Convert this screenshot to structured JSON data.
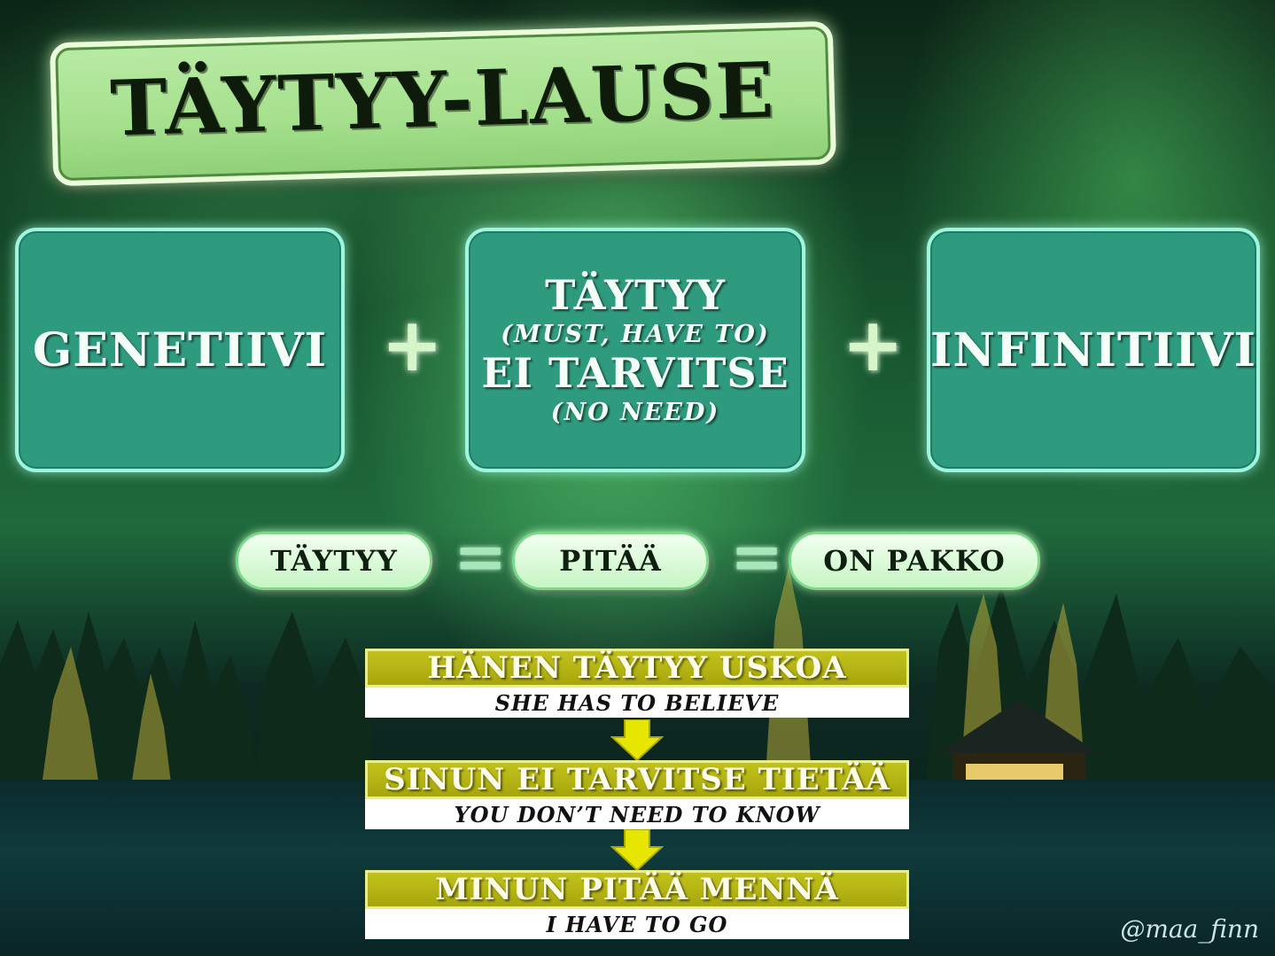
{
  "title": "TÄYTYY-LAUSE",
  "formula": {
    "left_box": "GENETIIVI",
    "plus_symbol": "+",
    "middle_box": {
      "line1": "TÄYTYY",
      "line1_gloss": "(MUST, HAVE TO)",
      "line2": "EI TARVITSE",
      "line2_gloss": "(NO NEED)"
    },
    "right_box": "INFINITIIVI"
  },
  "equivalents": {
    "items": [
      "TÄYTYY",
      "PITÄÄ",
      "ON PAKKO"
    ],
    "equals_symbol": "="
  },
  "examples": [
    {
      "finnish": "HÄNEN TÄYTYY USKOA",
      "english": "SHE HAS TO BELIEVE"
    },
    {
      "finnish": "SINUN EI TARVITSE TIETÄÄ",
      "english": "YOU DON’T NEED TO KNOW"
    },
    {
      "finnish": "MINUN PITÄÄ MENNÄ",
      "english": "I HAVE TO GO"
    }
  ],
  "watermark": "@maa_finn",
  "colors": {
    "box_fill": "#2f9b7e",
    "box_border": "#9ef6df",
    "title_fill": "#a5e08c",
    "example_bar": "#b4b414",
    "arrow": "#e6e600"
  },
  "icons": {
    "arrow": "down-arrow-icon",
    "plus": "plus-icon",
    "equals": "equals-icon"
  }
}
